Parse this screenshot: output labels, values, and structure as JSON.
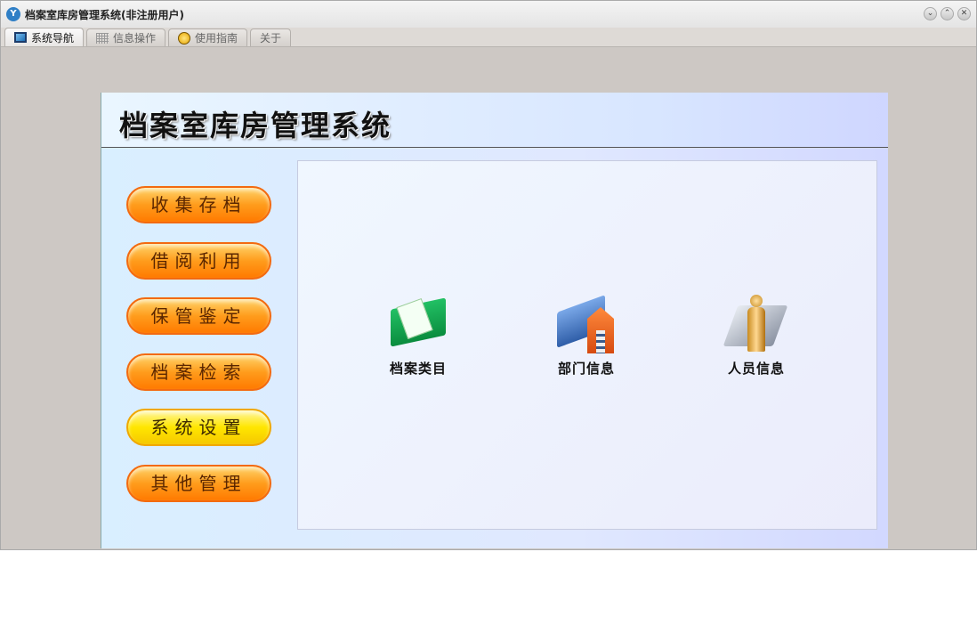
{
  "window": {
    "title": "档案室库房管理系统(非注册用户)",
    "controls": [
      "minimize",
      "maximize",
      "close"
    ]
  },
  "tabs": [
    {
      "label": "系统导航",
      "icon": "monitor-icon",
      "active": true
    },
    {
      "label": "信息操作",
      "icon": "grid-icon"
    },
    {
      "label": "使用指南",
      "icon": "help-icon"
    },
    {
      "label": "关于"
    }
  ],
  "header": {
    "title": "档案室库房管理系统"
  },
  "menu": [
    "收集存档",
    "借阅利用",
    "保管鉴定",
    "档案检索",
    "系统设置",
    "其他管理"
  ],
  "items": [
    {
      "label": "档案类目",
      "icon": "green-book-icon"
    },
    {
      "label": "部门信息",
      "icon": "department-house-icon"
    },
    {
      "label": "人员信息",
      "icon": "person-folder-icon"
    }
  ],
  "colors": {
    "menu_button": "#ff9c1c",
    "menu_button_highlight": "#ffe600",
    "body_bg": "#cdc8c4"
  }
}
